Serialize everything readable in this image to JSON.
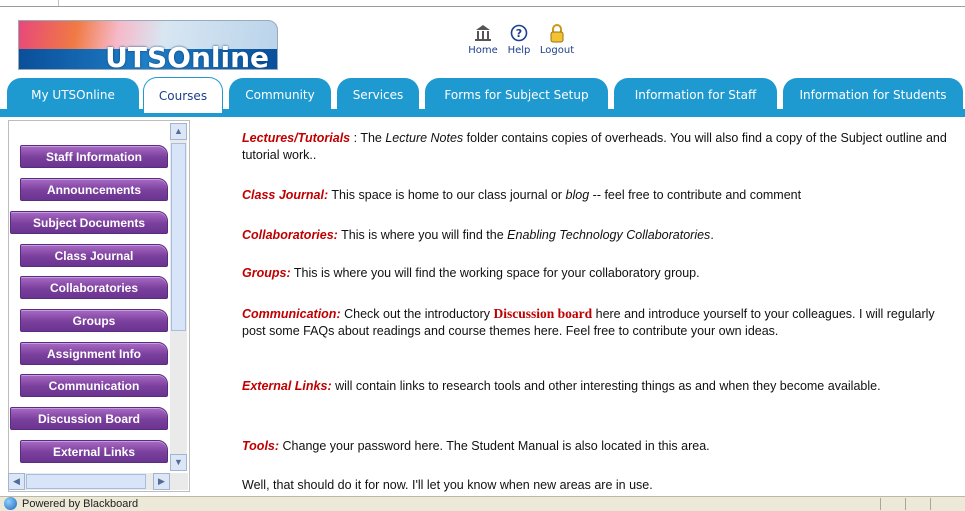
{
  "header": {
    "logo_text": "UTSOnline",
    "top_links": [
      {
        "label": "Home",
        "icon": "home-icon"
      },
      {
        "label": "Help",
        "icon": "help-icon"
      },
      {
        "label": "Logout",
        "icon": "lock-icon"
      }
    ]
  },
  "tabs": [
    {
      "label": "My UTSOnline"
    },
    {
      "label": "Courses"
    },
    {
      "label": "Community"
    },
    {
      "label": "Services"
    },
    {
      "label": "Forms for Subject Setup"
    },
    {
      "label": "Information for Staff"
    },
    {
      "label": "Information for Students"
    }
  ],
  "sidebar": {
    "items": [
      {
        "label": "Staff Information"
      },
      {
        "label": "Announcements"
      },
      {
        "label": "Subject Documents"
      },
      {
        "label": "Class Journal"
      },
      {
        "label": "Collaboratories"
      },
      {
        "label": "Groups"
      },
      {
        "label": "Assignment Info"
      },
      {
        "label": "Communication"
      },
      {
        "label": "Discussion Board"
      },
      {
        "label": "External Links"
      }
    ]
  },
  "content": {
    "lectures": {
      "keyword": "Lectures/Tutorials",
      "sep": " : ",
      "t1": "The ",
      "em": "Lecture Notes",
      "t2": " folder contains copies of overheads. You will also find a copy of the Subject outline and tutorial work.."
    },
    "journal": {
      "keyword": "Class Journal",
      "sep": ":",
      "t1": " This space is home to our class journal or ",
      "em": "blog",
      "t2": " -- feel free to contribute and comment"
    },
    "collab": {
      "keyword": "Collaboratories:",
      "t1": "  This is where you will find the ",
      "em": "Enabling Technology Collaboratories",
      "t2": "."
    },
    "groups": {
      "keyword": "Groups:",
      "t1": "  This is where you will find the working space for your collaboratory group."
    },
    "communication": {
      "keyword": "Communication",
      "sep": ":",
      "t1": " Check out the introductory ",
      "link": "Discussion board",
      "t2": " here and introduce yourself to your colleagues. I will regularly post some FAQs about readings and course themes here. Feel free to contribute your own ideas."
    },
    "external": {
      "keyword": "External Links",
      "sep": ":",
      "t1": " will contain links to research tools and other interesting things as and when they become available."
    },
    "tools": {
      "keyword": "Tools",
      "sep": ":",
      "t1": " Change your password here. The Student Manual is also located in this area."
    },
    "closing": "Well, that should do it for now. I'll let you know when new areas are in use."
  },
  "statusbar": {
    "text": "Powered by Blackboard"
  }
}
